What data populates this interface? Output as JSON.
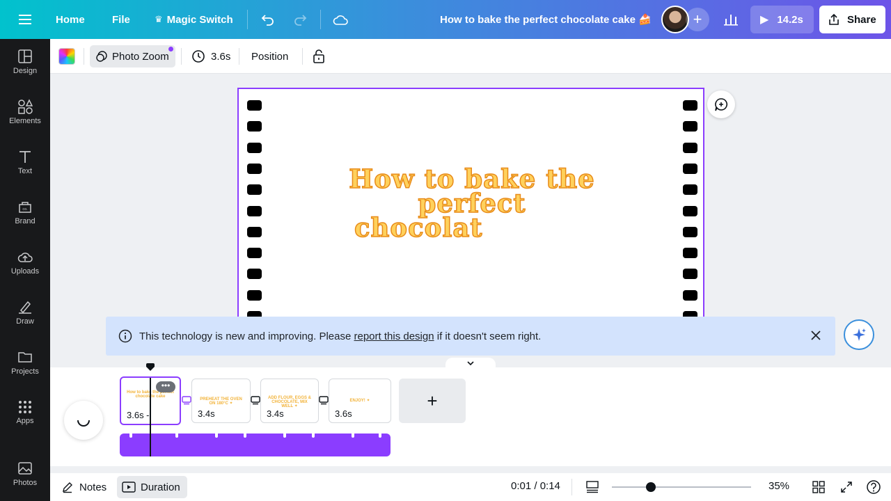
{
  "header": {
    "menu_icon": "hamburger-icon",
    "home_label": "Home",
    "file_label": "File",
    "magic_switch_label": "Magic Switch",
    "design_title": "How to bake the perfect chocolate cake 🍰",
    "play_duration": "14.2s",
    "share_label": "Share"
  },
  "sidebar": {
    "items": [
      {
        "label": "Design",
        "icon": "design-icon"
      },
      {
        "label": "Elements",
        "icon": "elements-icon"
      },
      {
        "label": "Text",
        "icon": "text-icon"
      },
      {
        "label": "Brand",
        "icon": "brand-icon"
      },
      {
        "label": "Uploads",
        "icon": "uploads-icon"
      },
      {
        "label": "Draw",
        "icon": "draw-icon"
      },
      {
        "label": "Projects",
        "icon": "projects-icon"
      },
      {
        "label": "Apps",
        "icon": "apps-icon"
      },
      {
        "label": "Photos",
        "icon": "photos-icon"
      }
    ]
  },
  "context_toolbar": {
    "photo_zoom_label": "Photo Zoom",
    "duration_label": "3.6s",
    "position_label": "Position"
  },
  "canvas": {
    "title_line1": "How to bake the",
    "title_line2": "perfect",
    "title_line3": "chocolat"
  },
  "banner": {
    "text_before": "This technology is new and improving. Please ",
    "link_text": "report this design",
    "text_after": " if it doesn't seem right."
  },
  "timeline": {
    "scenes": [
      {
        "duration": "3.6s -",
        "thumb_text": "How to bake the perfect chocolate cake"
      },
      {
        "duration": "3.4s",
        "thumb_text": "PREHEAT THE OVEN ON 180°C ✦"
      },
      {
        "duration": "3.4s",
        "thumb_text": "ADD FLOUR, EGGS & CHOCOLATE, MIX WELL ✦"
      },
      {
        "duration": "3.6s",
        "thumb_text": "ENJOY! ✦"
      }
    ],
    "more_label": "•••",
    "add_label": "+"
  },
  "bottom": {
    "notes_label": "Notes",
    "duration_label": "Duration",
    "time_text": "0:01 / 0:14",
    "zoom_pct": "35%",
    "zoom_level": 0.35
  },
  "colors": {
    "accent": "#8b3dff",
    "banner_bg": "#d3e3fd",
    "sidebar_bg": "#18191b"
  }
}
